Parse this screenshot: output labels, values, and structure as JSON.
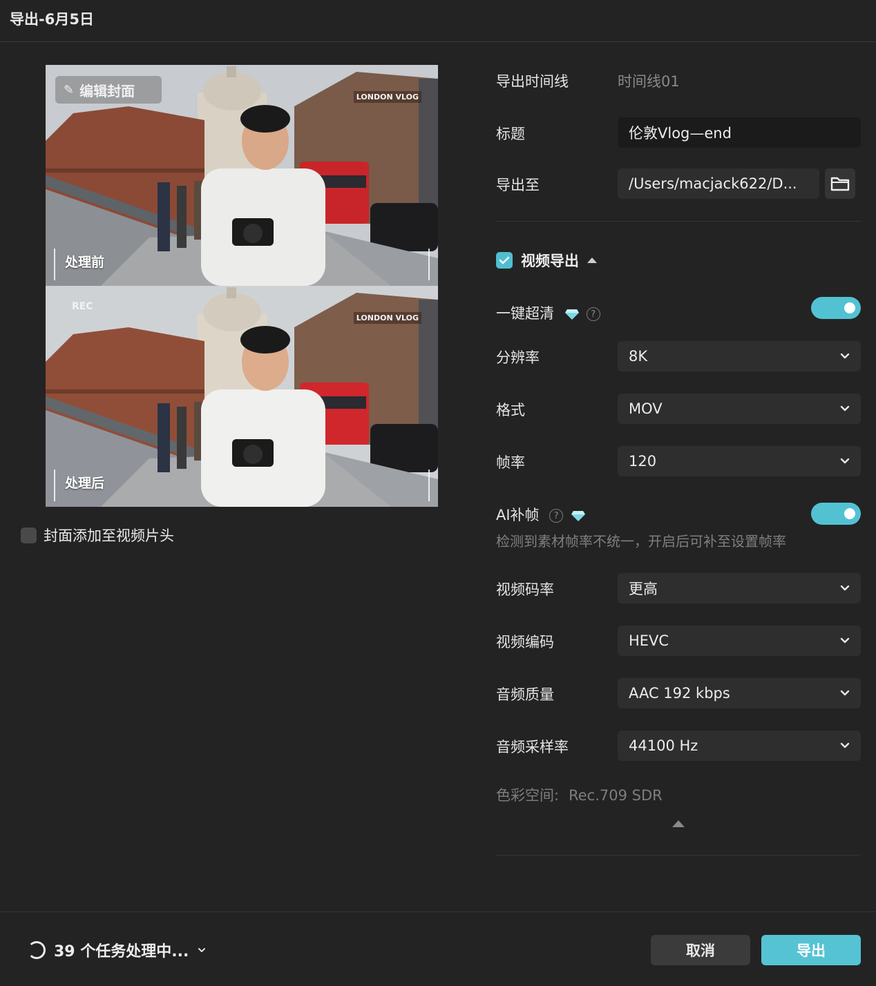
{
  "window": {
    "title": "导出-6月5日"
  },
  "preview": {
    "edit_cover_label": "编辑封面",
    "before_label": "处理前",
    "after_label": "处理后",
    "rec_label": "REC",
    "sign_text": "LONDON VLOG"
  },
  "cover_option": {
    "label": "封面添加至视频片头",
    "checked": false
  },
  "form": {
    "timeline_label": "导出时间线",
    "timeline_value": "时间线01",
    "title_label": "标题",
    "title_value": "伦敦Vlog—end",
    "export_to_label": "导出至",
    "export_to_value": "/Users/macjack622/D...",
    "video_export_label": "视频导出",
    "video_export_checked": true,
    "super_res_label": "一键超清",
    "super_res_on": true,
    "resolution_label": "分辨率",
    "resolution_value": "8K",
    "format_label": "格式",
    "format_value": "MOV",
    "fps_label": "帧率",
    "fps_value": "120",
    "ai_frame_label": "AI补帧",
    "ai_frame_on": true,
    "ai_frame_hint": "检测到素材帧率不统一，开启后可补至设置帧率",
    "bitrate_label": "视频码率",
    "bitrate_value": "更高",
    "codec_label": "视频编码",
    "codec_value": "HEVC",
    "audio_quality_label": "音频质量",
    "audio_quality_value": "AAC 192 kbps",
    "sample_rate_label": "音频采样率",
    "sample_rate_value": "44100 Hz",
    "color_space_label": "色彩空间:",
    "color_space_value": "Rec.709 SDR"
  },
  "footer": {
    "tasks_label": "39 个任务处理中...",
    "cancel_label": "取消",
    "export_label": "导出"
  },
  "colors": {
    "accent": "#52c2d3",
    "background": "#232323"
  }
}
